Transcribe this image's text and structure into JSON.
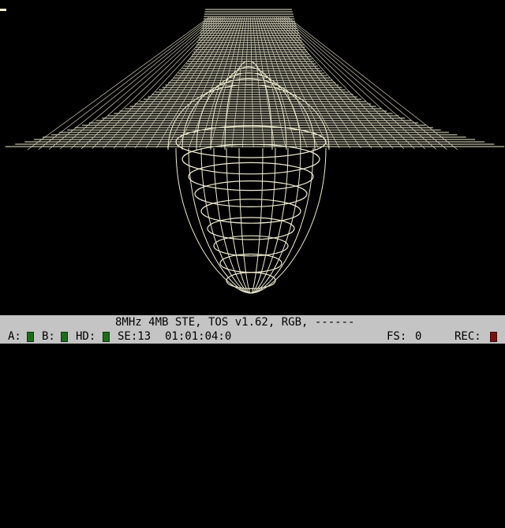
{
  "screen": {
    "background": "#000000",
    "foreground": "#f0ecd0",
    "content": "3d-wireframe-surface"
  },
  "statusbar": {
    "machine_info": "8MHz 4MB STE, TOS v1.62, RGB, ------",
    "drive_a_label": "A:",
    "drive_b_label": "B:",
    "hd_label": "HD:",
    "sector_label": "SE:13",
    "timecode": "01:01:04:0",
    "fs_label": "FS:",
    "fs_value": "0",
    "rec_label": "REC:",
    "led_color": "#1c6b1c",
    "rec_led_color": "#7a1010"
  }
}
